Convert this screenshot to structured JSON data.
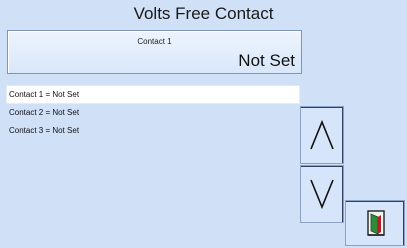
{
  "header": {
    "title": "Volts Free Contact"
  },
  "contact_panel": {
    "label": "Contact 1",
    "value": "Not Set"
  },
  "contacts": [
    {
      "text": "Contact 1 = Not Set",
      "selected": true
    },
    {
      "text": "Contact 2 = Not Set",
      "selected": false
    },
    {
      "text": "Contact 3 = Not Set",
      "selected": false
    }
  ],
  "icons": {
    "up": "chevron-up-icon",
    "down": "chevron-down-icon",
    "exit": "exit-door-icon"
  },
  "colors": {
    "background": "#cfe0f7",
    "selected_row": "#ffffff",
    "button_border": "#8aa2c6"
  }
}
